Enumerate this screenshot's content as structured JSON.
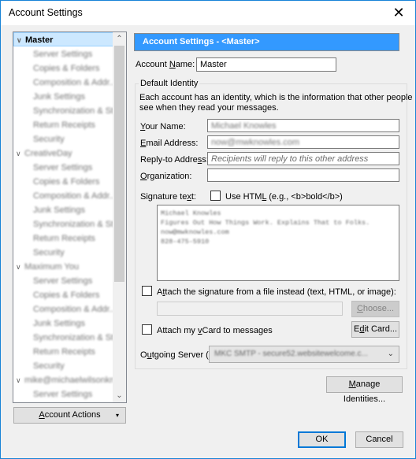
{
  "window": {
    "title": "Account Settings",
    "close_icon": "close-icon"
  },
  "tree": {
    "items": [
      {
        "label": "Master",
        "type": "account",
        "expanded": true,
        "selected": true
      },
      {
        "label": "Server Settings",
        "type": "sub"
      },
      {
        "label": "Copies & Folders",
        "type": "sub"
      },
      {
        "label": "Composition & Addr...",
        "type": "sub"
      },
      {
        "label": "Junk Settings",
        "type": "sub"
      },
      {
        "label": "Synchronization & St...",
        "type": "sub"
      },
      {
        "label": "Return Receipts",
        "type": "sub"
      },
      {
        "label": "Security",
        "type": "sub"
      },
      {
        "label": "CreativeDay",
        "type": "account",
        "expanded": true
      },
      {
        "label": "Server Settings",
        "type": "sub"
      },
      {
        "label": "Copies & Folders",
        "type": "sub"
      },
      {
        "label": "Composition & Addr...",
        "type": "sub"
      },
      {
        "label": "Junk Settings",
        "type": "sub"
      },
      {
        "label": "Synchronization & St...",
        "type": "sub"
      },
      {
        "label": "Return Receipts",
        "type": "sub"
      },
      {
        "label": "Security",
        "type": "sub"
      },
      {
        "label": "Maximum You",
        "type": "account",
        "expanded": true
      },
      {
        "label": "Server Settings",
        "type": "sub"
      },
      {
        "label": "Copies & Folders",
        "type": "sub"
      },
      {
        "label": "Composition & Addr...",
        "type": "sub"
      },
      {
        "label": "Junk Settings",
        "type": "sub"
      },
      {
        "label": "Synchronization & St...",
        "type": "sub"
      },
      {
        "label": "Return Receipts",
        "type": "sub"
      },
      {
        "label": "Security",
        "type": "sub"
      },
      {
        "label": "mike@michaelwilsonkn...",
        "type": "account",
        "expanded": true
      },
      {
        "label": "Server Settings",
        "type": "sub"
      }
    ],
    "scroll_up_icon": "^",
    "scroll_down_icon": "v"
  },
  "account_actions": {
    "label_pre": "",
    "label_mnemonic": "A",
    "label_post": "ccount Actions",
    "arrow": "▾"
  },
  "panel": {
    "header": "Account Settings - <Master>",
    "account_name_label_pre": "Account ",
    "account_name_label_mn": "N",
    "account_name_label_post": "ame:",
    "account_name_value": "Master",
    "default_identity_legend": "Default Identity",
    "identity_desc_line1": "Each account has an identity, which is the information that other people",
    "identity_desc_line2": "see when they read your messages.",
    "your_name_mn": "Y",
    "your_name_post": "our Name:",
    "your_name_value": "Michael Knowles",
    "email_mn": "E",
    "email_post": "mail Address:",
    "email_value": "now@mwknowles.com",
    "reply_pre": "Reply-to Addre",
    "reply_mn": "s",
    "reply_post": "s:",
    "reply_placeholder": "Recipients will reply to this other address",
    "org_mn": "O",
    "org_post": "rganization:",
    "org_value": "",
    "signature_label_pre": "Signature te",
    "signature_label_mn": "x",
    "signature_label_post": "t:",
    "use_html_pre": "Use HTM",
    "use_html_mn": "L",
    "use_html_post": " (e.g., <b>bold</b>)",
    "use_html_checked": false,
    "signature_lines": [
      "Michael Knowles",
      "Figures Out How Things Work. Explains That to Folks.",
      "now@mwknowles.com",
      "828-475-5910"
    ],
    "attach_file_pre": "A",
    "attach_file_mn": "t",
    "attach_file_post": "tach the signature from a file instead (text, HTML, or image):",
    "attach_file_checked": false,
    "attach_file_path": "",
    "choose_mn": "C",
    "choose_post": "hoose...",
    "vcard_pre": "Attach my ",
    "vcard_mn": "v",
    "vcard_post": "Card to messages",
    "vcard_checked": false,
    "edit_card_pre": "E",
    "edit_card_mn": "d",
    "edit_card_post": "it Card...",
    "smtp_pre": "O",
    "smtp_mn": "u",
    "smtp_post": "tgoing Server (SMTP):",
    "smtp_value": "MKC SMTP - secure52.websitewelcome.c...",
    "manage_mn": "M",
    "manage_post": "anage Identities..."
  },
  "footer": {
    "ok": "OK",
    "cancel": "Cancel"
  },
  "colors": {
    "accent": "#3399ff",
    "selection": "#cce8ff",
    "focus_border": "#0078d7"
  }
}
